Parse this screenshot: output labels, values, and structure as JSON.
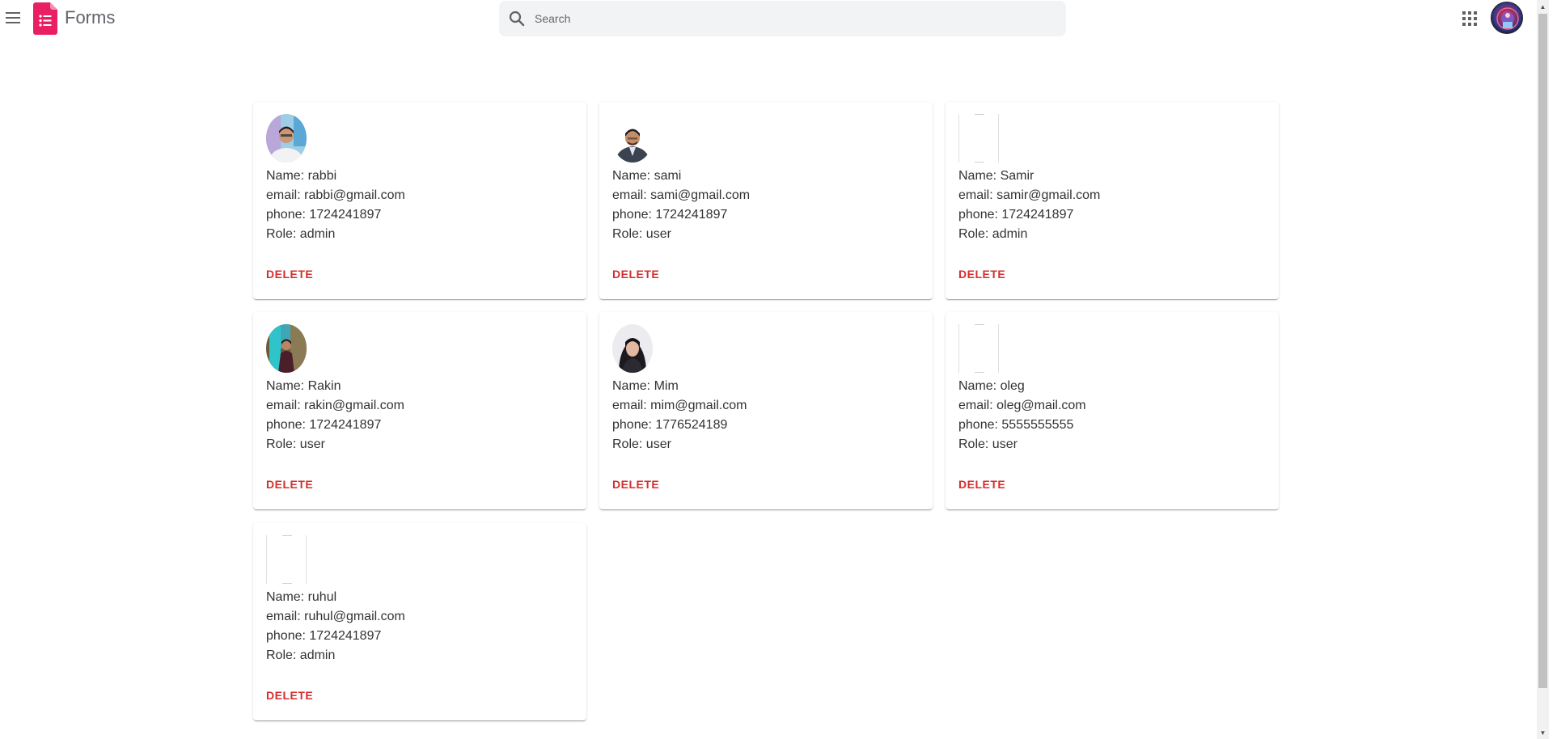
{
  "header": {
    "app_title": "Forms",
    "menu_icon": "hamburger-menu-icon",
    "logo_icon": "forms-logo-icon",
    "logo_color": "#e91e63",
    "search_placeholder": "Search",
    "search_value": "",
    "apps_icon": "apps-grid-icon",
    "avatar_icon": "user-avatar"
  },
  "colors": {
    "delete": "#d32f2f",
    "logo": "#e91e63"
  },
  "labels": {
    "name_prefix": "Name: ",
    "email_prefix": "email: ",
    "phone_prefix": "phone: ",
    "role_prefix": "Role: ",
    "delete": "DELETE"
  },
  "users": [
    {
      "name": "rabbi",
      "email": "rabbi@gmail.com",
      "phone": "1724241897",
      "role": "admin",
      "photo": "photo-rabbi",
      "name_line": "Name: rabbi",
      "email_line": "email: rabbi@gmail.com",
      "phone_line": "phone: 1724241897",
      "role_line": "Role: admin"
    },
    {
      "name": "sami",
      "email": "sami@gmail.com",
      "phone": "1724241897",
      "role": "user",
      "photo": "photo-sami",
      "name_line": "Name: sami",
      "email_line": "email: sami@gmail.com",
      "phone_line": "phone: 1724241897",
      "role_line": "Role: user"
    },
    {
      "name": "Samir",
      "email": "samir@gmail.com",
      "phone": "1724241897",
      "role": "admin",
      "photo": "none",
      "name_line": "Name: Samir",
      "email_line": "email: samir@gmail.com",
      "phone_line": "phone: 1724241897",
      "role_line": "Role: admin"
    },
    {
      "name": "Rakin",
      "email": "rakin@gmail.com",
      "phone": "1724241897",
      "role": "user",
      "photo": "photo-rakin",
      "name_line": "Name: Rakin",
      "email_line": "email: rakin@gmail.com",
      "phone_line": "phone: 1724241897",
      "role_line": "Role: user"
    },
    {
      "name": "Mim",
      "email": "mim@gmail.com",
      "phone": "1776524189",
      "role": "user",
      "photo": "photo-mim",
      "name_line": "Name: Mim",
      "email_line": "email: mim@gmail.com",
      "phone_line": "phone: 1776524189",
      "role_line": "Role: user"
    },
    {
      "name": "oleg",
      "email": "oleg@mail.com",
      "phone": "5555555555",
      "role": "user",
      "photo": "none",
      "name_line": "Name: oleg",
      "email_line": "email: oleg@mail.com",
      "phone_line": "phone: 5555555555",
      "role_line": "Role: user"
    },
    {
      "name": "ruhul",
      "email": "ruhul@gmail.com",
      "phone": "1724241897",
      "role": "admin",
      "photo": "none",
      "name_line": "Name: ruhul",
      "email_line": "email: ruhul@gmail.com",
      "phone_line": "phone: 1724241897",
      "role_line": "Role: admin"
    }
  ]
}
